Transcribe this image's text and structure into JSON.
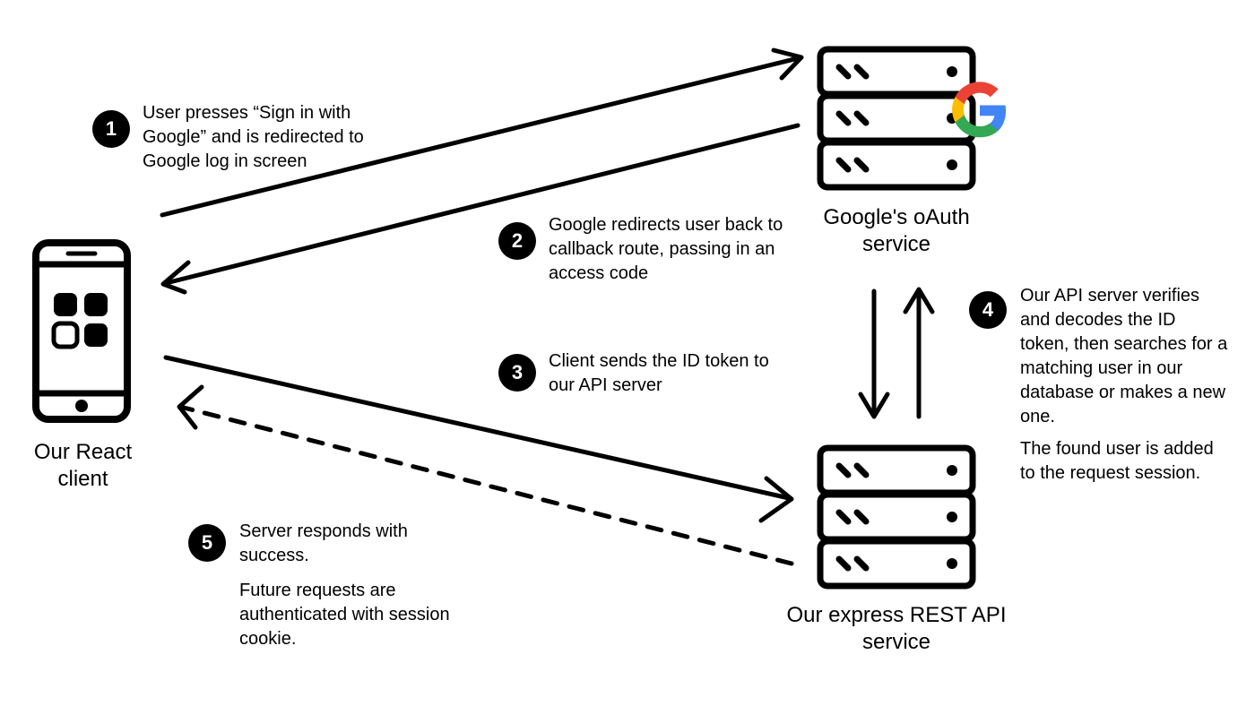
{
  "nodes": {
    "client_label": "Our React\nclient",
    "google_label": "Google's oAuth\nservice",
    "api_label": "Our express REST API\nservice"
  },
  "steps": {
    "s1": {
      "num": "1",
      "text": "User presses “Sign in with Google” and is redirected to Google log in screen"
    },
    "s2": {
      "num": "2",
      "text": "Google redirects user back to callback route, passing in an access code"
    },
    "s3": {
      "num": "3",
      "text": "Client sends the ID token to our API server"
    },
    "s4": {
      "num": "4",
      "text_a": "Our API server verifies and decodes the ID token, then searches for a matching user in our database or makes a new one.",
      "text_b": "The found user is added to the request session."
    },
    "s5": {
      "num": "5",
      "text_a": "Server responds with success.",
      "text_b": "Future requests are authenticated with session cookie."
    }
  }
}
